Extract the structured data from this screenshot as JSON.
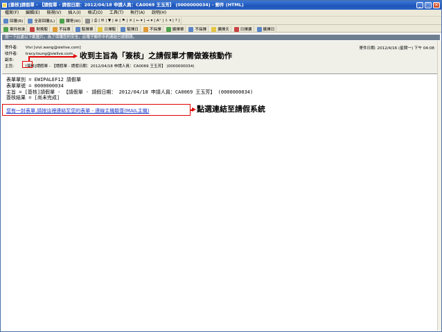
{
  "window": {
    "title": "[簽核]請假單 - 【請假單 - 請假日期：2012/04/18 申請人員：CA0069 王玉芳】 (0000000034) - 郵件 (HTML)"
  },
  "menu": [
    "檔案(F)",
    "編輯(E)",
    "檢視(V)",
    "插入(I)",
    "格式(O)",
    "工具(T)",
    "執行(A)",
    "說明(H)"
  ],
  "toolbar1": {
    "reply": "回覆(R)",
    "reply_all": "全部回覆(L)",
    "forward": "轉寄(W)",
    "symbols": "| ⎙ | ✉ | ▼ | ⊕ | ⚑ | ✕ | ← ▾ | → ▾ | A⁺ | ⇩ ▾ | ? |"
  },
  "toolbar2": {
    "items": [
      "案件核准",
      "財務駁",
      "不採單",
      "駁擇單",
      "日擇駁",
      "駁擇日",
      "不採擇",
      "擴擇單",
      "不採擇",
      "擴擇天",
      "日擇擴",
      "擴擇日"
    ]
  },
  "infobar": {
    "text": "按一下此處以下載圖片。為了保護您的安全，此電子郵件中的連結已經關閉。"
  },
  "header": {
    "from_label": "寄件者:",
    "from_value": "Vivi [vivi.wang@sielive.com]",
    "to_label": "收件者:",
    "to_value": "tracy.tsung@sielive.com",
    "cc_label": "副本:",
    "cc_value": "",
    "subject_label": "主旨:",
    "subject_value": "[簽核]請假單 - 【請假單 - 請假日期：2012/04/18 申請人員：CA0069 王玉芳】 (0000000034)",
    "sent_label": "寄件日期:",
    "sent_value": "2012/4/16 (星期一) 下午 04:08"
  },
  "annotations": {
    "subject_note": "收到主旨為「簽核」之請假單才需做簽核動作",
    "link_note": "點選連結至請假系統"
  },
  "body": {
    "line1": "表單單別 = EWIPALEF12 請假單",
    "line2": "表單單號 = 0000000034",
    "line3": "主旨 = [簽核]請假單 - 【請假單 - 請假日期： 2012/04/18 申請人員：CA0069 王玉芳】 (0000000034)",
    "line4": "簽核結果 = [尚未完成]",
    "link": "您有一封表單,請按這裡連結至您的表單 - 連線主機驗簽(MAIL主機)"
  }
}
